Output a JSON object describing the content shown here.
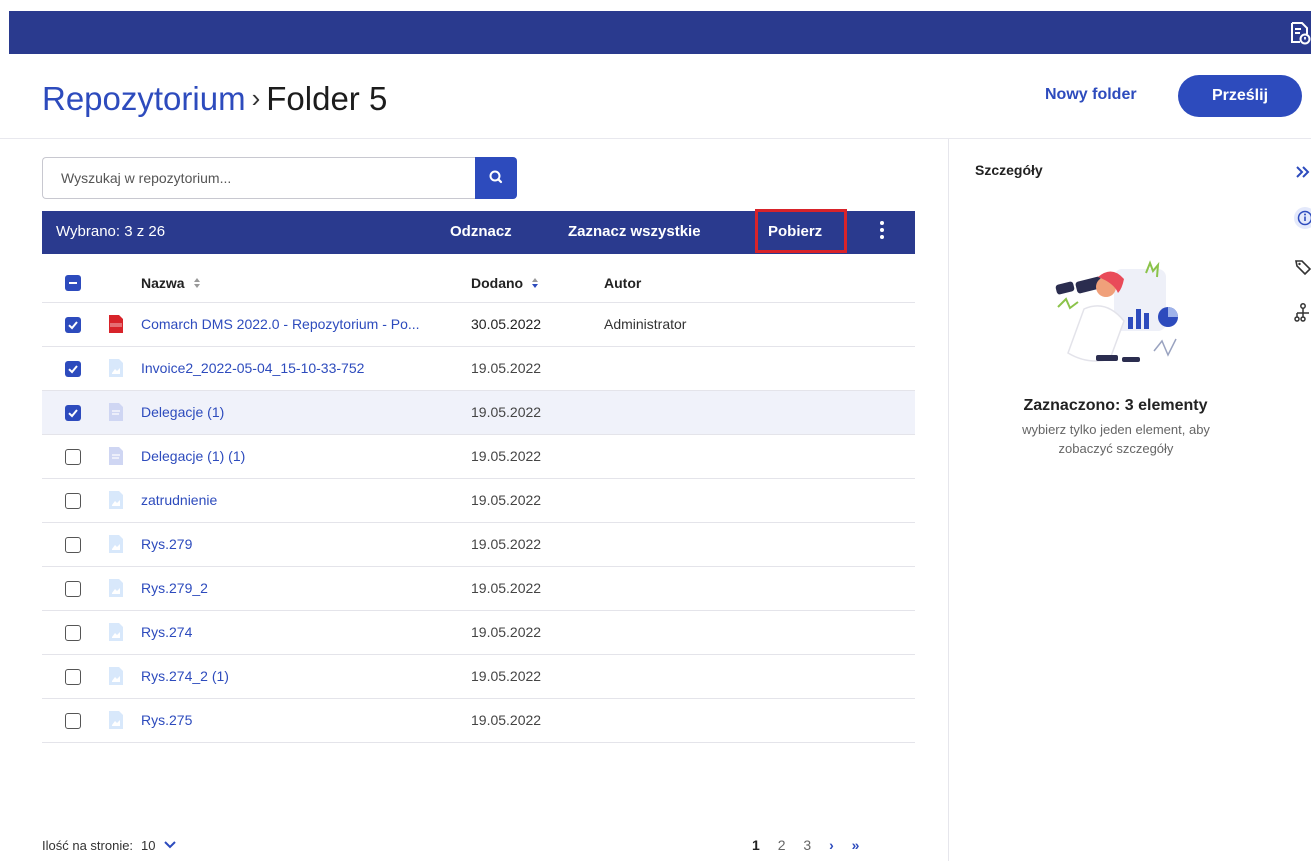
{
  "header": {
    "breadcrumb_root": "Repozytorium",
    "breadcrumb_sep": "›",
    "breadcrumb_current": "Folder 5",
    "new_folder_label": "Nowy folder",
    "send_label": "Prześlij"
  },
  "search": {
    "placeholder": "Wyszukaj w repozytorium..."
  },
  "selection_bar": {
    "count_text": "Wybrano: 3 z 26",
    "unselect_label": "Odznacz",
    "select_all_label": "Zaznacz wszystkie",
    "download_label": "Pobierz"
  },
  "table": {
    "headers": {
      "name": "Nazwa",
      "added": "Dodano",
      "author": "Autor"
    },
    "rows": [
      {
        "name": "Comarch DMS 2022.0 - Repozytorium - Po...",
        "date": "30.05.2022",
        "author": "Administrator",
        "checked": true,
        "icon": "pdf-file-icon"
      },
      {
        "name": "Invoice2_2022-05-04_15-10-33-752",
        "date": "19.05.2022",
        "author": "",
        "checked": true,
        "icon": "image-file-icon"
      },
      {
        "name": "Delegacje (1)",
        "date": "19.05.2022",
        "author": "",
        "checked": true,
        "icon": "doc-file-icon"
      },
      {
        "name": "Delegacje (1) (1)",
        "date": "19.05.2022",
        "author": "",
        "checked": false,
        "icon": "doc-file-icon"
      },
      {
        "name": "zatrudnienie",
        "date": "19.05.2022",
        "author": "",
        "checked": false,
        "icon": "image-file-icon"
      },
      {
        "name": "Rys.279",
        "date": "19.05.2022",
        "author": "",
        "checked": false,
        "icon": "image-file-icon"
      },
      {
        "name": "Rys.279_2",
        "date": "19.05.2022",
        "author": "",
        "checked": false,
        "icon": "image-file-icon"
      },
      {
        "name": "Rys.274",
        "date": "19.05.2022",
        "author": "",
        "checked": false,
        "icon": "image-file-icon"
      },
      {
        "name": "Rys.274_2 (1)",
        "date": "19.05.2022",
        "author": "",
        "checked": false,
        "icon": "image-file-icon"
      },
      {
        "name": "Rys.275",
        "date": "19.05.2022",
        "author": "",
        "checked": false,
        "icon": "image-file-icon"
      }
    ]
  },
  "footer": {
    "per_page_label": "Ilość na stronie:",
    "per_page_value": "10",
    "pages": [
      "1",
      "2",
      "3"
    ],
    "current_page": "1",
    "next_symbol": "›",
    "last_symbol": "»"
  },
  "details": {
    "title": "Szczegóły",
    "selected_title": "Zaznaczono: 3 elementy",
    "hint": "wybierz tylko jeden element, aby zobaczyć szczegóły"
  },
  "colors": {
    "primary": "#2d4bbd",
    "navy_bar": "#2a3a8e",
    "highlight_border": "#d8232a",
    "pdf_red": "#d8232a"
  }
}
